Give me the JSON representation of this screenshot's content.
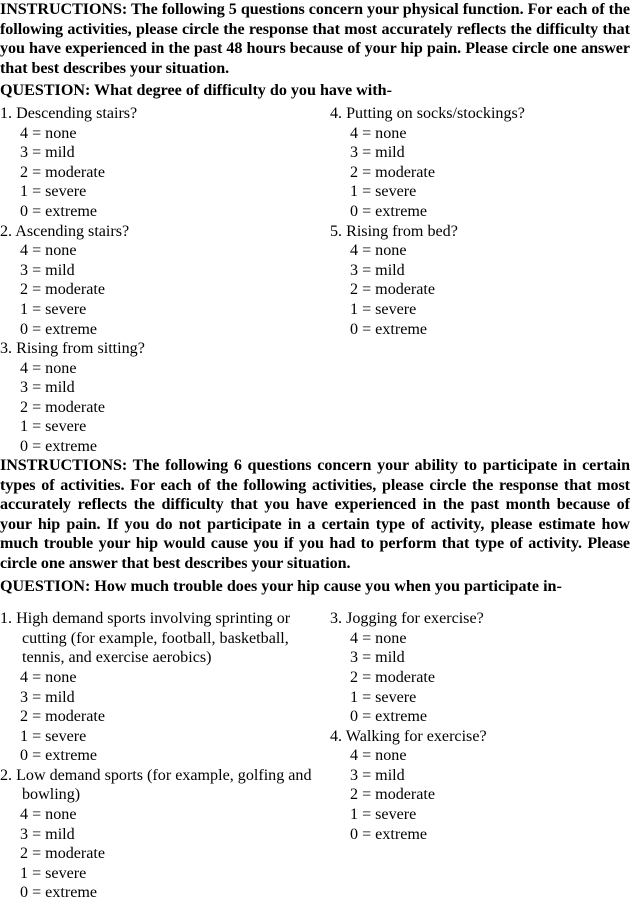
{
  "document": {
    "background_color": "#ffffff",
    "text_color": "#000000"
  },
  "scale": {
    "options": [
      {
        "value": "4",
        "eq": "=",
        "label": "none"
      },
      {
        "value": "3",
        "eq": "=",
        "label": "mild"
      },
      {
        "value": "2",
        "eq": "=",
        "label": "moderate"
      },
      {
        "value": "1",
        "eq": "=",
        "label": "severe"
      },
      {
        "value": "0",
        "eq": "=",
        "label": "extreme"
      }
    ]
  },
  "section_physical_function": {
    "instructions": "INSTRUCTIONS: The following 5 questions concern your physical function. For each of the following activities, please circle the response that most accurately reflects the difficulty that you have experienced in the past 48 hours because of your hip pain. Please circle one answer that best describes your situation.",
    "question_prompt": "QUESTION: What degree of difficulty do you have with-",
    "left_column": [
      {
        "number": "1.",
        "text": "Descending stairs?",
        "options": [
          {
            "value": "4",
            "eq": "=",
            "label": "none"
          },
          {
            "value": "3",
            "eq": "=",
            "label": "mild"
          },
          {
            "value": "2",
            "eq": "=",
            "label": "moderate"
          },
          {
            "value": "1",
            "eq": "=",
            "label": "severe"
          },
          {
            "value": "0",
            "eq": "=",
            "label": "extreme"
          }
        ]
      },
      {
        "number": "2.",
        "text": "Ascending stairs?",
        "options": [
          {
            "value": "4",
            "eq": "=",
            "label": "none"
          },
          {
            "value": "3",
            "eq": "=",
            "label": "mild"
          },
          {
            "value": "2",
            "eq": "=",
            "label": "moderate"
          },
          {
            "value": "1",
            "eq": "=",
            "label": "severe"
          },
          {
            "value": "0",
            "eq": "=",
            "label": "extreme"
          }
        ]
      },
      {
        "number": "3.",
        "text": "Rising from sitting?",
        "options": [
          {
            "value": "4",
            "eq": "=",
            "label": "none"
          },
          {
            "value": "3",
            "eq": "=",
            "label": "mild"
          },
          {
            "value": "2",
            "eq": "=",
            "label": "moderate"
          },
          {
            "value": "1",
            "eq": "=",
            "label": "severe"
          },
          {
            "value": "0",
            "eq": "=",
            "label": "extreme"
          }
        ]
      }
    ],
    "right_column": [
      {
        "number": "4.",
        "text": "Putting on socks/stockings?",
        "options": [
          {
            "value": "4",
            "eq": "=",
            "label": "none"
          },
          {
            "value": "3",
            "eq": "=",
            "label": "mild"
          },
          {
            "value": "2",
            "eq": "=",
            "label": "moderate"
          },
          {
            "value": "1",
            "eq": "=",
            "label": "severe"
          },
          {
            "value": "0",
            "eq": "=",
            "label": "extreme"
          }
        ]
      },
      {
        "number": "5.",
        "text": "Rising from bed?",
        "options": [
          {
            "value": "4",
            "eq": "=",
            "label": "none"
          },
          {
            "value": "3",
            "eq": "=",
            "label": "mild"
          },
          {
            "value": "2",
            "eq": "=",
            "label": "moderate"
          },
          {
            "value": "1",
            "eq": "=",
            "label": "severe"
          },
          {
            "value": "0",
            "eq": "=",
            "label": "extreme"
          }
        ]
      }
    ]
  },
  "section_activities": {
    "instructions": "INSTRUCTIONS: The following 6 questions concern your ability to participate in certain types of activities. For each of the following activities, please circle the response that most accurately reflects the difficulty that you have experienced in the past month because of your hip pain. If you do not participate in a certain type of activity, please estimate how much trouble your hip would cause you if you had to perform that type of activity. Please circle one answer that best describes your situation.",
    "question_prompt": "QUESTION: How much trouble does your hip cause you when you participate in-",
    "left_column": [
      {
        "number": "1.",
        "text": "High demand sports involving sprinting or cutting (for example, football, basketball, tennis, and exercise aerobics)",
        "options": [
          {
            "value": "4",
            "eq": "=",
            "label": "none"
          },
          {
            "value": "3",
            "eq": "=",
            "label": "mild"
          },
          {
            "value": "2",
            "eq": "=",
            "label": "moderate"
          },
          {
            "value": "1",
            "eq": "=",
            "label": "severe"
          },
          {
            "value": "0",
            "eq": "=",
            "label": "extreme"
          }
        ]
      },
      {
        "number": "2.",
        "text": "Low demand sports (for example, golfing and bowling)",
        "options": [
          {
            "value": "4",
            "eq": "=",
            "label": "none"
          },
          {
            "value": "3",
            "eq": "=",
            "label": "mild"
          },
          {
            "value": "2",
            "eq": "=",
            "label": "moderate"
          },
          {
            "value": "1",
            "eq": "=",
            "label": "severe"
          },
          {
            "value": "0",
            "eq": "=",
            "label": "extreme"
          }
        ]
      }
    ],
    "right_column": [
      {
        "number": "3.",
        "text": "Jogging for exercise?",
        "options": [
          {
            "value": "4",
            "eq": "=",
            "label": "none"
          },
          {
            "value": "3",
            "eq": "=",
            "label": "mild"
          },
          {
            "value": "2",
            "eq": "=",
            "label": "moderate"
          },
          {
            "value": "1",
            "eq": "=",
            "label": "severe"
          },
          {
            "value": "0",
            "eq": "=",
            "label": "extreme"
          }
        ]
      },
      {
        "number": "4.",
        "text": "Walking for exercise?",
        "options": [
          {
            "value": "4",
            "eq": "=",
            "label": "none"
          },
          {
            "value": "3",
            "eq": "=",
            "label": "mild"
          },
          {
            "value": "2",
            "eq": "=",
            "label": "moderate"
          },
          {
            "value": "1",
            "eq": "=",
            "label": "severe"
          },
          {
            "value": "0",
            "eq": "=",
            "label": "extreme"
          }
        ]
      }
    ]
  }
}
